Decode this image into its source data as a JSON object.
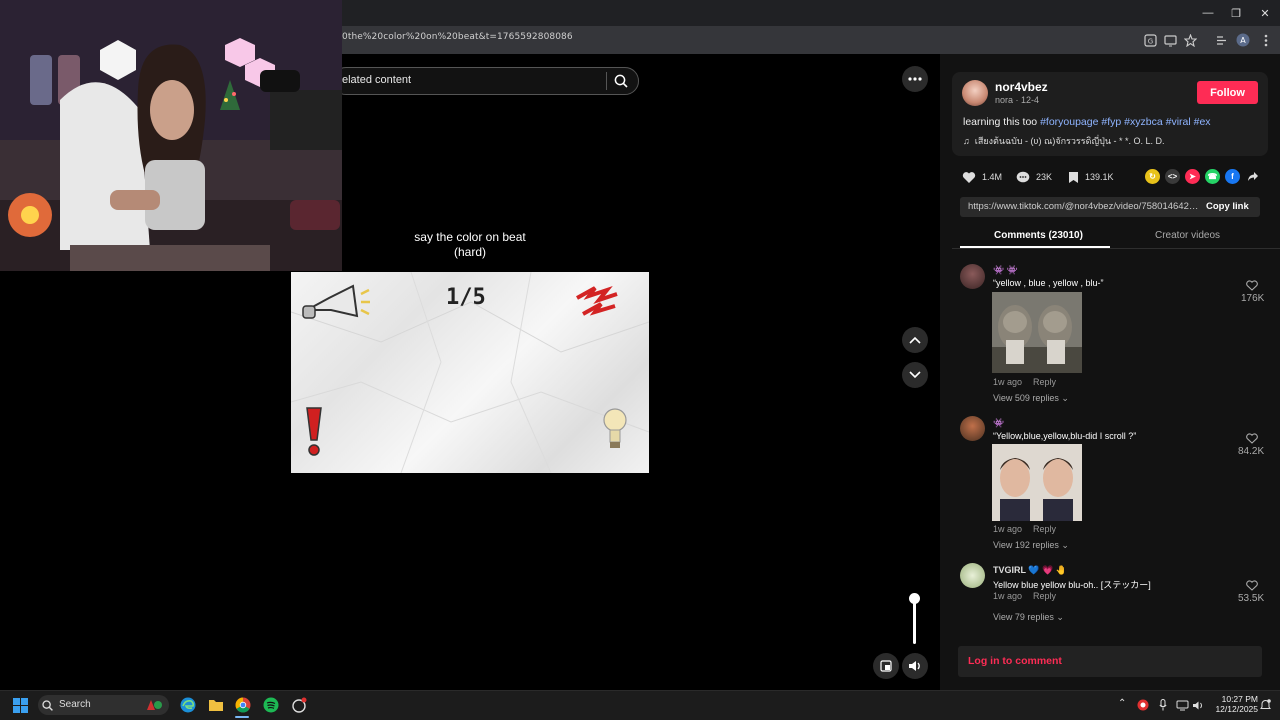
{
  "browser": {
    "url": "0the%20color%20on%20beat&t=1765592808086"
  },
  "video": {
    "search_text": "elated content",
    "caption_line1": "say the color on beat",
    "caption_line2": "(hard)",
    "game_counter": "1/5",
    "volume_fraction": 1.0
  },
  "post": {
    "username": "nor4vbez",
    "display_name": "nora",
    "date": "12-4",
    "follow_label": "Follow",
    "description_text": "learning this too",
    "hashtags": [
      "#foryoupage",
      "#fyp",
      "#xyzbca",
      "#viral",
      "#ex"
    ],
    "music": "เสียงต้นฉบับ - (ʋ) ณ)จักรวรรดิญี่ปุ่น - * *. O. L. D.",
    "likes": "1.4M",
    "comments": "23K",
    "saves": "139.1K",
    "share_link": "https://www.tiktok.com/@nor4vbez/video/7580146422...",
    "copy_link_label": "Copy link"
  },
  "tabs": {
    "comments": "Comments (23010)",
    "creator_videos": "Creator videos"
  },
  "comments": [
    {
      "name": "👾 👾",
      "text": "“yellow , blue , yellow , blu-”",
      "time": "1w ago",
      "reply": "Reply",
      "view_replies": "View 509 replies",
      "likes": "176K"
    },
    {
      "name": "👾",
      "text": "“Yellow,blue,yellow,blu-did I scroll ?”",
      "time": "1w ago",
      "reply": "Reply",
      "view_replies": "View 192 replies",
      "likes": "84.2K"
    },
    {
      "name": "TVGIRL 💙 💗 🤚",
      "text": "Yellow blue yellow blu-oh.. [ステッカー]",
      "time": "1w ago",
      "reply": "Reply",
      "view_replies": "View 79 replies",
      "likes": "53.5K"
    }
  ],
  "login": {
    "label": "Log in to comment"
  },
  "taskbar": {
    "search_label": "Search",
    "time": "10:27 PM",
    "date": "12/12/2025"
  },
  "icons": {
    "start": "windows-icon",
    "edge": "edge-icon",
    "explorer": "folder-icon",
    "chrome": "chrome-icon",
    "spotify": "spotify-icon"
  },
  "colors": {
    "accent": "#fe2c55",
    "hashtag": "#8fb4ff",
    "panel_bg": "#121212"
  }
}
